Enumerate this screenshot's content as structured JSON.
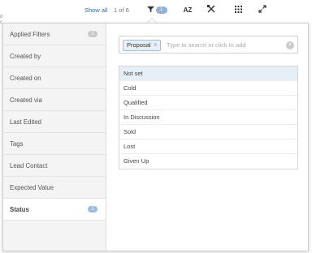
{
  "toolbar": {
    "show_all": "Show all",
    "pager": "1 of 6",
    "filter_count": "1",
    "sort_label": "AZ"
  },
  "sidebar": {
    "items": [
      {
        "label": "Applied Filters",
        "badge": "1"
      },
      {
        "label": "Created by"
      },
      {
        "label": "Created on"
      },
      {
        "label": "Created via"
      },
      {
        "label": "Last Edited"
      },
      {
        "label": "Tags"
      },
      {
        "label": "Lead Contact"
      },
      {
        "label": "Expected Value"
      },
      {
        "label": "Status",
        "badge": "1"
      }
    ],
    "active": "Status"
  },
  "filter": {
    "selected_chip": "Proposal",
    "chip_remove": "x",
    "placeholder": "Type to search or click to add",
    "options": [
      "Not set",
      "Cold",
      "Qualified",
      "In Discussion",
      "Sold",
      "Lost",
      "Given Up"
    ]
  },
  "colors": {
    "link": "#2b6cb0",
    "badge": "#8fb2d6",
    "chip_bg": "#e6f0f8",
    "highlight_row": "#e6eef6"
  }
}
